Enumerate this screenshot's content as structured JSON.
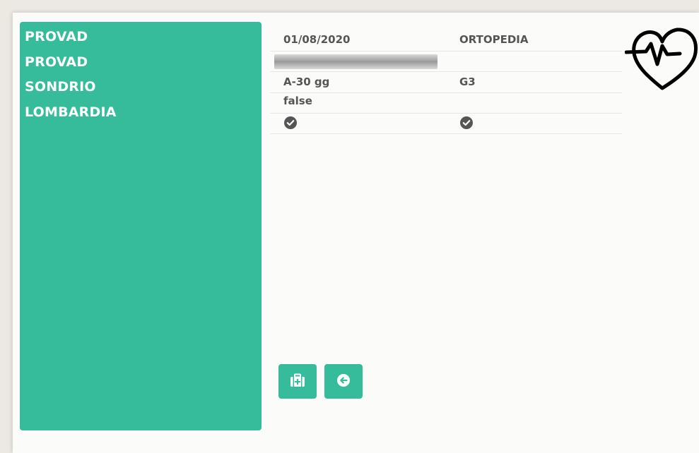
{
  "sidebar": {
    "lines": [
      "PROVAD",
      "PROVAD",
      "SONDRIO",
      "LOMBARDIA"
    ]
  },
  "details": {
    "date": "01/08/2020",
    "specialty": "ORTOPEDIA",
    "priority": "A-30 gg",
    "grade": "G3",
    "flag": "false"
  },
  "buttons": {
    "medkit": "medkit-icon",
    "back": "arrow-left-circle-icon"
  },
  "icons": {
    "logo": "heart-pulse-icon",
    "check": "check-circle-icon"
  },
  "colors": {
    "accent": "#37bc9b",
    "text": "#555555"
  }
}
